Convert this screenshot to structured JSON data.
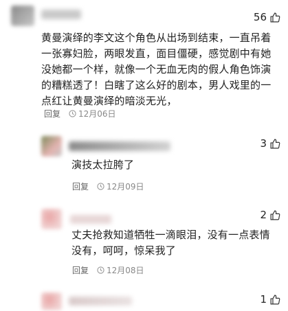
{
  "comments": [
    {
      "likes": "56",
      "text": "黄曼演绎的李文这个角色从出场到结束，一直吊着一张寡妇脸，两眼发直，面目僵硬，感觉剧中有她没她都一个样，就像一个无血无肉的假人角色饰演的糟糕透了！白瞎了这么好的剧本，男人戏里的一点红让黄曼演绎的暗淡无光，",
      "reply_label": "回复",
      "date": "12月06日"
    },
    {
      "likes": "3",
      "text": "演技太拉胯了",
      "reply_label": "回复",
      "date": "12月09日"
    },
    {
      "likes": "2",
      "text": "丈夫抢救知道牺牲一滴眼泪，没有一点表情没有，呵呵，惊呆我了",
      "reply_label": "回复",
      "date": "12月08日"
    },
    {
      "likes": "1"
    }
  ],
  "icons": {
    "like": "thumbs-up-icon",
    "time": "clock-icon"
  },
  "colors": {
    "text": "#222222",
    "meta": "#888888",
    "background": "#ffffff"
  }
}
